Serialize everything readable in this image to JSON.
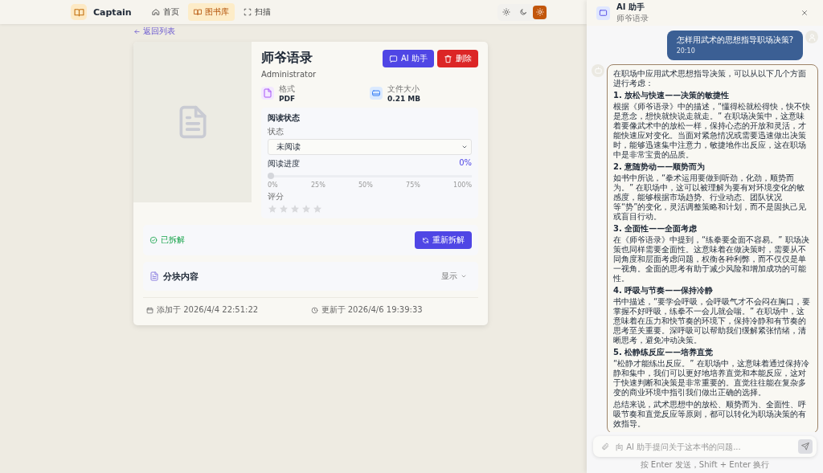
{
  "app": {
    "name": "Captain"
  },
  "nav": [
    {
      "label": "首页",
      "selected": false
    },
    {
      "label": "图书库",
      "selected": true
    },
    {
      "label": "扫描",
      "selected": false
    }
  ],
  "theme_buttons": [
    {
      "selected": false
    },
    {
      "selected": false
    },
    {
      "selected": true
    }
  ],
  "back_link": "返回列表",
  "book": {
    "title": "师爷语录",
    "author": "Administrator",
    "actions": [
      {
        "label": "AI 助手",
        "kind": "ai"
      },
      {
        "label": "删除",
        "kind": "delete"
      }
    ],
    "info": [
      {
        "label": "格式",
        "value": "PDF",
        "kind": "format"
      },
      {
        "label": "文件大小",
        "value": "0.21 MB",
        "kind": "size"
      }
    ],
    "reading": {
      "title": "阅读状态",
      "status_label": "状态",
      "status_value": "未阅读",
      "progress_label": "阅读进度",
      "progress_value": "0%",
      "level": 0,
      "ticks": [
        "0%",
        "25%",
        "50%",
        "75%",
        "100%"
      ],
      "rating_label": "评分",
      "stars": 0
    },
    "parse": {
      "status": "已拆解",
      "button": "重新拆解"
    },
    "chunks": {
      "title": "分块内容",
      "toggle": "显示",
      "expanded": false
    },
    "added": "添加于 2026/4/4 22:51:22",
    "updated": "更新于 2026/4/6 19:39:33"
  },
  "chat": {
    "title": "AI 助手",
    "subtitle": "师爷语录",
    "messages": [
      {
        "kind": "user",
        "time": "20:10",
        "blocks": [
          {
            "kind": "p",
            "text": "怎样用武术的思想指导职场决策?"
          }
        ]
      },
      {
        "kind": "assistant",
        "blocks": [
          {
            "kind": "p",
            "text": "在职场中应用武术思想指导决策，可以从以下几个方面进行考虑："
          },
          {
            "kind": "h",
            "text": "1. 放松与快速——决策的敏捷性"
          },
          {
            "kind": "p",
            "text": "根据《师爷语录》中的描述，“懂得松就松得快，快不快是意念，想快就快说走就走。” 在职场决策中，这意味着要像武术中的放松一样，保持心态的开放和灵活，才能快速应对变化。当面对紧急情况或需要迅速做出决策时，能够迅速集中注意力，敏捷地作出反应，这在职场中是非常宝贵的品质。"
          },
          {
            "kind": "h",
            "text": "2. 意随势动——顺势而为"
          },
          {
            "kind": "p",
            "text": "如书中所说，“拳术运用要做到听劲，化劲，顺势而为。” 在职场中，这可以被理解为要有对环境变化的敏感度，能够根据市场趋势、行业动态、团队状况等“势”的变化，灵活调整策略和计划，而不是固执己见或盲目行动。"
          },
          {
            "kind": "h",
            "text": "3. 全面性——全面考虑"
          },
          {
            "kind": "p",
            "text": "在《师爷语录》中提到，“练拳要全面不容易。” 职场决策也同样需要全面性。这意味着在做决策时，需要从不同角度和层面考虑问题，权衡各种利弊，而不仅仅是单一视角。全面的思考有助于减少风险和增加成功的可能性。"
          },
          {
            "kind": "h",
            "text": "4. 呼吸与节奏——保持冷静"
          },
          {
            "kind": "p",
            "text": "书中描述，“要学会呼吸，会呼吸气才不会闷在胸口，要掌握不好呼吸，练拳不一会儿就会喘。” 在职场中，这意味着在压力和快节奏的环境下，保持冷静和有节奏的思考至关重要。深呼吸可以帮助我们缓解紧张情绪，清晰思考，避免冲动决策。"
          },
          {
            "kind": "h",
            "text": "5. 松静练反应——培养直觉"
          },
          {
            "kind": "p",
            "text": "“松静才能练出反应。” 在职场中，这意味着通过保持冷静和集中，我们可以更好地培养直觉和本能反应，这对于快速判断和决策是非常重要的。直觉往往能在复杂多变的商业环境中指引我们做出正确的选择。"
          },
          {
            "kind": "p",
            "text": "总结来说，武术思想中的放松、顺势而为、全面性、呼吸节奏和直觉反应等原则，都可以转化为职场决策的有效指导。"
          }
        ]
      }
    ],
    "placeholder": "向 AI 助手提问关于这本书的问题...",
    "hint": "按 Enter 发送，Shift + Enter 换行"
  }
}
